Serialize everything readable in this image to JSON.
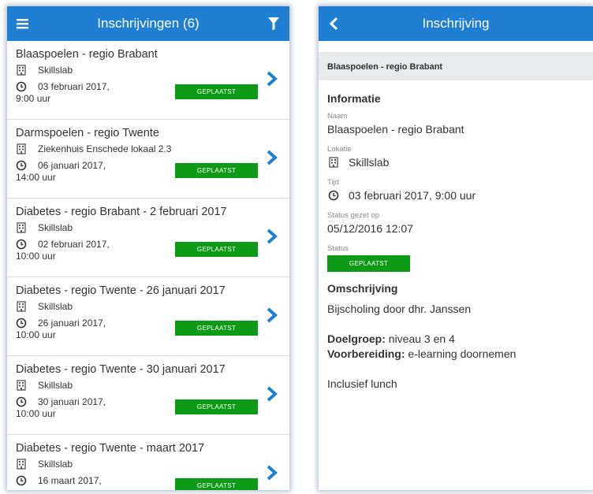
{
  "left_screen": {
    "title": "Inschrijvingen (6)",
    "menu_icon": "hamburger-icon",
    "filter_icon": "filter-icon",
    "items": [
      {
        "name": "Blaaspoelen - regio Brabant",
        "location": "Skillslab",
        "date": "03 februari 2017,",
        "hour": "9:00 uur",
        "status": "GEPLAATST"
      },
      {
        "name": "Darmspoelen - regio Twente",
        "location": "Ziekenhuis Enschede lokaal 2.3",
        "date": "06 januari 2017,",
        "hour": "14:00 uur",
        "status": "GEPLAATST"
      },
      {
        "name": "Diabetes - regio Brabant - 2 februari 2017",
        "location": "Skillslab",
        "date": "02 februari 2017,",
        "hour": "10:00 uur",
        "status": "GEPLAATST"
      },
      {
        "name": "Diabetes - regio Twente - 26 januari 2017",
        "location": "Skillslab",
        "date": "26 januari 2017,",
        "hour": "10:00 uur",
        "status": "GEPLAATST"
      },
      {
        "name": "Diabetes - regio Twente - 30 januari 2017",
        "location": "Skillslab",
        "date": "30 januari 2017,",
        "hour": "10:00 uur",
        "status": "GEPLAATST"
      },
      {
        "name": "Diabetes - regio Twente - maart 2017",
        "location": "Skillslab",
        "date": "16 maart 2017,",
        "hour": "",
        "status": "GEPLAATST"
      }
    ]
  },
  "right_screen": {
    "title": "Inschrijving",
    "back_icon": "chevron-left-icon",
    "subtitle": "Blaaspoelen - regio Brabant",
    "section_info": "Informatie",
    "naam_label": "Naam",
    "naam_value": "Blaaspoelen - regio Brabant",
    "lokatie_label": "Lokatie",
    "lokatie_value": "Skillslab",
    "tijd_label": "Tijd",
    "tijd_value": "03 februari 2017, 9:00 uur",
    "status_gezet_label": "Status gezet op",
    "status_gezet_value": "05/12/2016 12:07",
    "status_label": "Status",
    "status_value": "GEPLAATST",
    "section_omschrijving": "Omschrijving",
    "omschrijving_text": "Bijscholing door dhr. Janssen",
    "doelgroep_label": "Doelgroep:",
    "doelgroep_value": " niveau 3 en 4",
    "voorbereiding_label": "Voorbereiding:",
    "voorbereiding_value": " e-learning doornemen",
    "extra_text": "Inclusief lunch"
  },
  "colors": {
    "appbar": "#1f7fd3",
    "badge": "#0d9a16",
    "subbar": "#e9eaec"
  }
}
